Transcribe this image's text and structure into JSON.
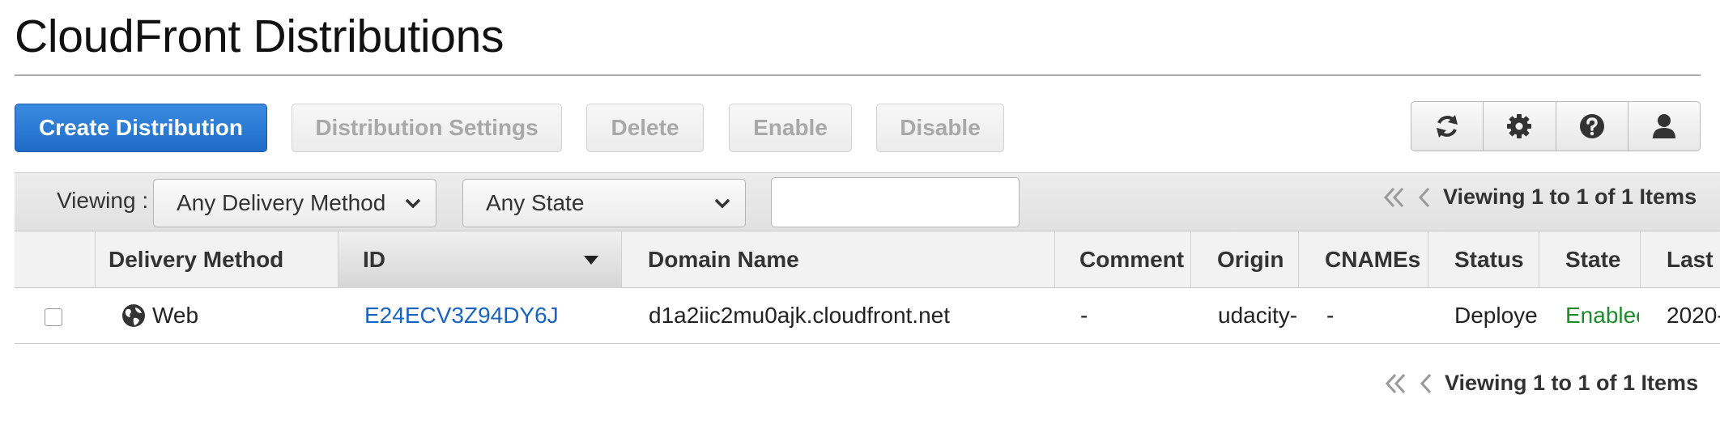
{
  "page": {
    "title": "CloudFront Distributions"
  },
  "toolbar": {
    "create_label": "Create Distribution",
    "settings_label": "Distribution Settings",
    "delete_label": "Delete",
    "enable_label": "Enable",
    "disable_label": "Disable",
    "icons": [
      "refresh-icon",
      "gear-icon",
      "help-icon",
      "user-icon"
    ]
  },
  "filters": {
    "viewing_label": "Viewing :",
    "delivery_method": "Any Delivery Method",
    "state": "Any State",
    "search_value": "",
    "pager_text": "Viewing 1 to 1 of 1 Items"
  },
  "table": {
    "columns": [
      "Delivery Method",
      "ID",
      "Domain Name",
      "Comment",
      "Origin",
      "CNAMEs",
      "Status",
      "State",
      "Last"
    ],
    "rows": [
      {
        "delivery_method": "Web",
        "id": "E24ECV3Z94DY6J",
        "domain_name": "d1a2iic2mu0ajk.cloudfront.net",
        "comment": "-",
        "origin": "udacity-",
        "cnames": "-",
        "status": "Deploye",
        "state": "Enablec",
        "last": "2020-"
      }
    ]
  },
  "footer": {
    "pager_text": "Viewing 1 to 1 of 1 Items"
  },
  "colors": {
    "primary": "#1f6cc8",
    "link": "#1a64c0",
    "enabled": "#1f8a2d"
  }
}
